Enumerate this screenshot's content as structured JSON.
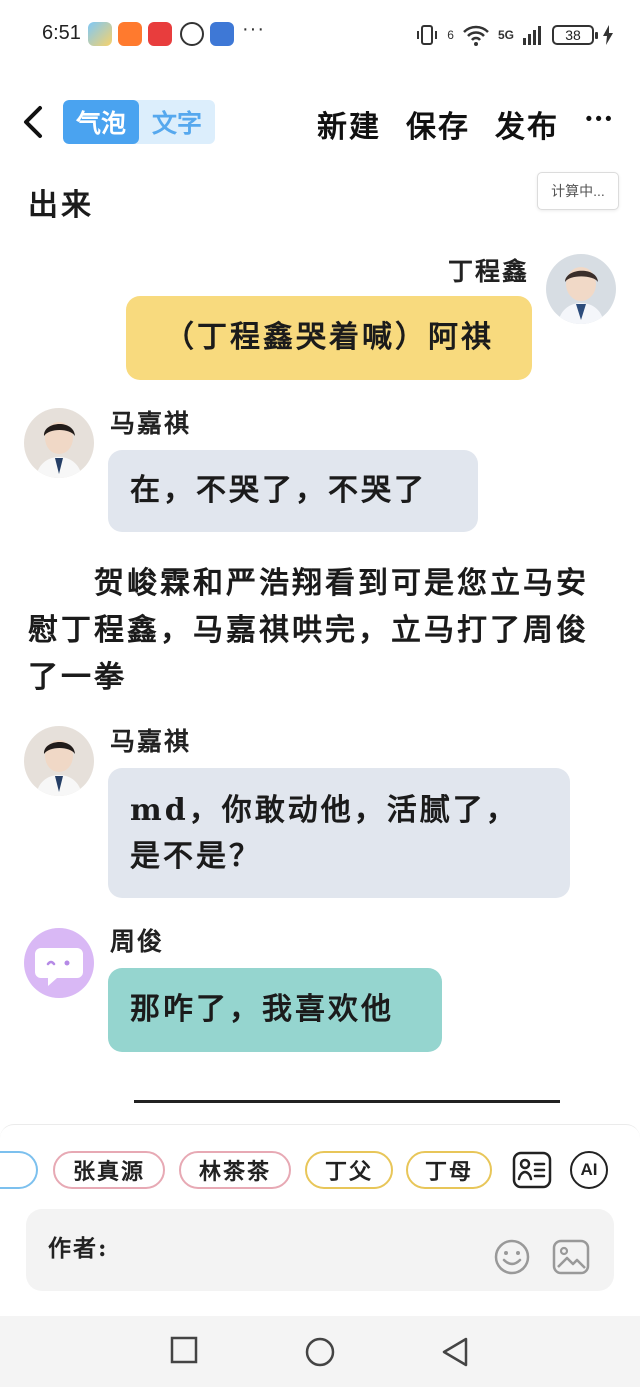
{
  "status_bar": {
    "time": "6:51",
    "more": "···",
    "battery": "38",
    "network": "5G",
    "sim_label": "6"
  },
  "toolbar": {
    "toggle_bubble": "气泡",
    "toggle_text": "文字",
    "new_label": "新建",
    "save_label": "保存",
    "publish_label": "发布",
    "more_label": "···"
  },
  "calc_badge": "计算中...",
  "messages": {
    "top_narration": "出来",
    "m1_speaker": "丁程鑫",
    "m1_text": "（丁程鑫哭着喊）阿祺",
    "m2_speaker": "马嘉祺",
    "m2_text": "在，不哭了，不哭了",
    "narration_2": "　　贺峻霖和严浩翔看到可是您立马安慰丁程鑫，马嘉祺哄完，立马打了周俊了一拳",
    "m3_speaker": "马嘉祺",
    "m3_text": "md，你敢动他，活腻了，是不是？",
    "m4_speaker": "周俊",
    "m4_text": "那咋了，我喜欢他"
  },
  "chips": [
    {
      "label": "张真源",
      "color": "#e7a9b4"
    },
    {
      "label": "林茶茶",
      "color": "#e7a9b4"
    },
    {
      "label": "丁父",
      "color": "#e8c659"
    },
    {
      "label": "丁母",
      "color": "#e8c659"
    }
  ],
  "input": {
    "author_label": "作者:",
    "ai_label": "AI"
  },
  "colors": {
    "accent": "#4aa3f0",
    "bubble_yellow": "#f8da7e",
    "bubble_grey": "#e1e6ee",
    "bubble_teal": "#95d5cf",
    "avatar_purple": "#d9b8f5"
  }
}
